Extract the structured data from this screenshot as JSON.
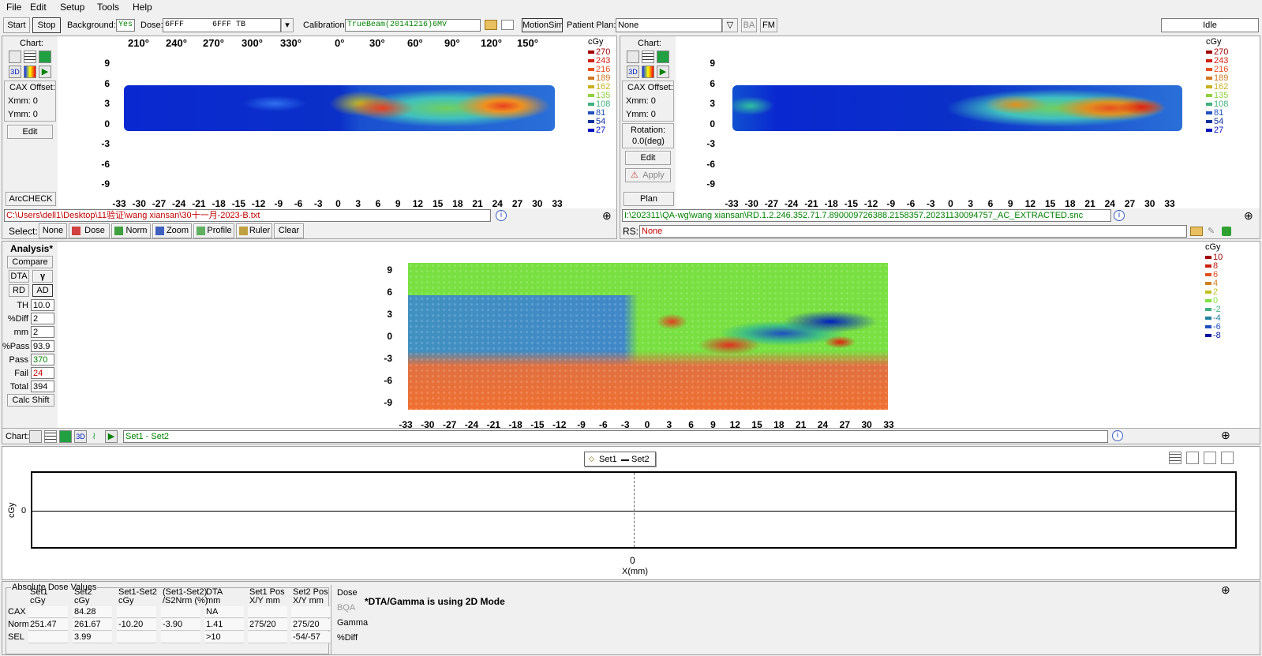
{
  "menu": [
    "File",
    "Edit",
    "Setup",
    "Tools",
    "Help"
  ],
  "toolbar": {
    "start": "Start",
    "stop": "Stop",
    "background_label": "Background:",
    "background_value": "Yes",
    "dose_label": "Dose:",
    "dose_value": "6FFF      6FFF TB",
    "calibration_label": "Calibration:",
    "calibration_value": "TrueBeam(20141216)6MV",
    "motionsim": "MotionSim",
    "patient_plan_label": "Patient Plan:",
    "patient_plan_value": "None",
    "ba": "BA",
    "fm": "FM",
    "status": "Idle"
  },
  "left_panel": {
    "chart": "Chart:",
    "cax_offset": "CAX Offset:",
    "xmm": "Xmm: 0",
    "ymm": "Ymm: 0",
    "edit": "Edit",
    "arccheck": "ArcCHECK",
    "angles": [
      "210°",
      "240°",
      "270°",
      "300°",
      "330°",
      "0°",
      "30°",
      "60°",
      "90°",
      "120°",
      "150°"
    ],
    "path": "C:\\Users\\dell1\\Desktop\\11验证\\wang xiansan\\30十一月-2023-B.txt",
    "select_label": "Select:",
    "select_buttons": [
      "None",
      "Dose",
      "Norm",
      "Zoom",
      "Profile",
      "Ruler",
      "Clear"
    ]
  },
  "right_panel": {
    "chart": "Chart:",
    "cax_offset": "CAX Offset:",
    "xmm": "Xmm: 0",
    "ymm": "Ymm: 0",
    "rotation": "Rotation:",
    "rotation_value": "0.0(deg)",
    "edit": "Edit",
    "apply": "Apply",
    "plan": "Plan",
    "path": "I:\\202311\\QA-wg\\wang xiansan\\RD.1.2.246.352.71.7.890009726388.2158357.20231130094757_AC_EXTRACTED.snc",
    "rs_label": "RS:",
    "rs_value": "None"
  },
  "dose_map": {
    "y_ticks": [
      "9",
      "6",
      "3",
      "0",
      "-3",
      "-6",
      "-9"
    ],
    "x_ticks": [
      "-33",
      "-30",
      "-27",
      "-24",
      "-21",
      "-18",
      "-15",
      "-12",
      "-9",
      "-6",
      "-3",
      "0",
      "3",
      "6",
      "9",
      "12",
      "15",
      "18",
      "21",
      "24",
      "27",
      "30",
      "33"
    ],
    "legend_title": "cGy",
    "legend": [
      {
        "label": "270",
        "color": "#a00000"
      },
      {
        "label": "243",
        "color": "#d02010"
      },
      {
        "label": "216",
        "color": "#e85020"
      },
      {
        "label": "189",
        "color": "#d07820"
      },
      {
        "label": "162",
        "color": "#c8b020"
      },
      {
        "label": "135",
        "color": "#90d040"
      },
      {
        "label": "108",
        "color": "#40b080"
      },
      {
        "label": "81",
        "color": "#2050c0"
      },
      {
        "label": "54",
        "color": "#1030a0"
      },
      {
        "label": "27",
        "color": "#0010c0"
      }
    ]
  },
  "analysis": {
    "title": "Analysis*",
    "compare": "Compare",
    "dta": "DTA",
    "gamma": "γ",
    "rd": "RD",
    "ad": "AD",
    "fields": [
      {
        "label": "TH",
        "value": "10.0",
        "color": "#000000"
      },
      {
        "label": "%Diff",
        "value": "2",
        "color": "#000000"
      },
      {
        "label": "mm",
        "value": "2",
        "color": "#000000"
      },
      {
        "label": "%Pass",
        "value": "93.9",
        "color": "#000000"
      },
      {
        "label": "Pass",
        "value": "370",
        "color": "#008000"
      },
      {
        "label": "Fail",
        "value": "24",
        "color": "#c00000"
      },
      {
        "label": "Total",
        "value": "394",
        "color": "#000000"
      }
    ],
    "calc_shift": "Calc Shift",
    "legend_title": "cGy",
    "legend": [
      {
        "label": "10",
        "color": "#a00000"
      },
      {
        "label": "8",
        "color": "#c82010"
      },
      {
        "label": "6",
        "color": "#e05020"
      },
      {
        "label": "4",
        "color": "#d08020"
      },
      {
        "label": "2",
        "color": "#c0c020"
      },
      {
        "label": "0",
        "color": "#80e040"
      },
      {
        "label": "-2",
        "color": "#40b080"
      },
      {
        "label": "-4",
        "color": "#2080a0"
      },
      {
        "label": "-6",
        "color": "#2050c0"
      },
      {
        "label": "-8",
        "color": "#0010a0"
      }
    ],
    "chart_label": "Chart:",
    "set_label": "Set1 - Set2"
  },
  "profile": {
    "legend_set1": "Set1",
    "legend_set2": "Set2",
    "ylabel": "cGy",
    "y_tick": "0",
    "x_tick": "0",
    "xlabel": "X(mm)"
  },
  "absolute_dose": {
    "title": "Absolute Dose Values",
    "headers": [
      [
        "Set1",
        "cGy"
      ],
      [
        "Set2",
        "cGy"
      ],
      [
        "Set1-Set2",
        "cGy"
      ],
      [
        "(Set1-Set2)",
        "/S2Nrm (%)"
      ],
      [
        "DTA",
        "mm"
      ],
      [
        "Set1 Pos",
        "X/Y mm"
      ],
      [
        "Set2 Pos",
        "X/Y mm"
      ]
    ],
    "rows": [
      {
        "label": "CAX",
        "cells": [
          "",
          "84.28",
          "",
          "",
          "NA",
          "",
          ""
        ]
      },
      {
        "label": "Norm",
        "cells": [
          "251.47",
          "261.67",
          "-10.20",
          "-3.90",
          "1.41",
          "275/20",
          "275/20"
        ]
      },
      {
        "label": "SEL",
        "cells": [
          "",
          "3.99",
          "",
          "",
          ">10",
          "",
          "-54/-57"
        ]
      }
    ],
    "side": [
      "Dose",
      "BQA",
      "Gamma",
      "%Diff"
    ],
    "note": "*DTA/Gamma is using 2D Mode"
  }
}
